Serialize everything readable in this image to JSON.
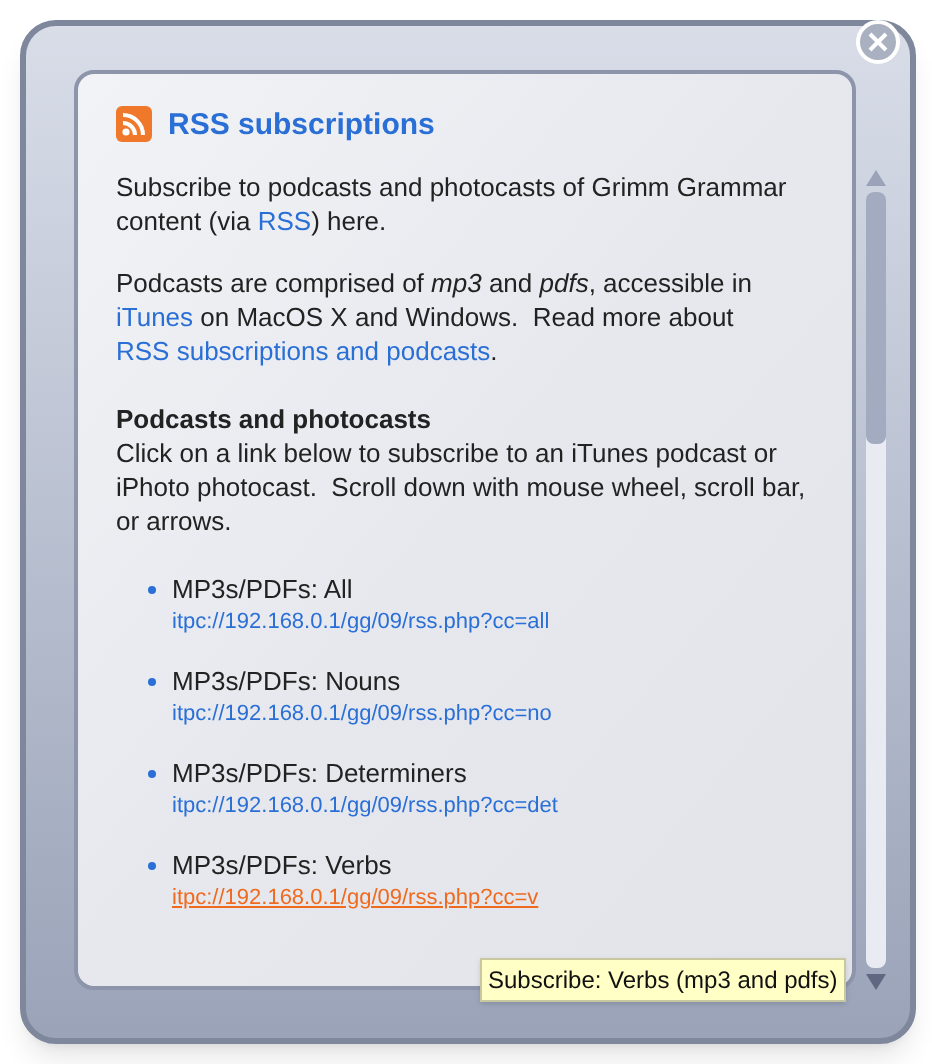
{
  "title": "RSS subscriptions",
  "paragraphs": [
    [
      {
        "kind": "text",
        "text": "Subscribe to podcasts and photocasts of Grimm Grammar content (via "
      },
      {
        "kind": "link",
        "text": "RSS"
      },
      {
        "kind": "text",
        "text": ") here."
      }
    ],
    [
      {
        "kind": "text",
        "text": "Podcasts are comprised of *mp3* and *pdfs*, accessible in "
      },
      {
        "kind": "link",
        "text": "iTunes"
      },
      {
        "kind": "text",
        "text": " on MacOS X and Windows.  Read more about "
      },
      {
        "kind": "link",
        "text": "RSS subscriptions and podcasts"
      },
      {
        "kind": "text",
        "text": "."
      }
    ]
  ],
  "section": {
    "heading": "Podcasts and photocasts",
    "text": "Click on a link below to subscribe to an iTunes podcast or iPhoto photocast.  Scroll down with mouse wheel, scroll bar, or arrows."
  },
  "feeds": [
    {
      "label": "MP3s/PDFs: All",
      "url": "itpc://192.168.0.1/gg/09/rss.php?cc=all",
      "hovered": false
    },
    {
      "label": "MP3s/PDFs: Nouns",
      "url": "itpc://192.168.0.1/gg/09/rss.php?cc=no",
      "hovered": false
    },
    {
      "label": "MP3s/PDFs: Determiners",
      "url": "itpc://192.168.0.1/gg/09/rss.php?cc=det",
      "hovered": false
    },
    {
      "label": "MP3s/PDFs: Verbs",
      "url": "itpc://192.168.0.1/gg/09/rss.php?cc=v",
      "hovered": true
    }
  ],
  "tooltip": "Subscribe: Verbs (mp3 and pdfs)"
}
